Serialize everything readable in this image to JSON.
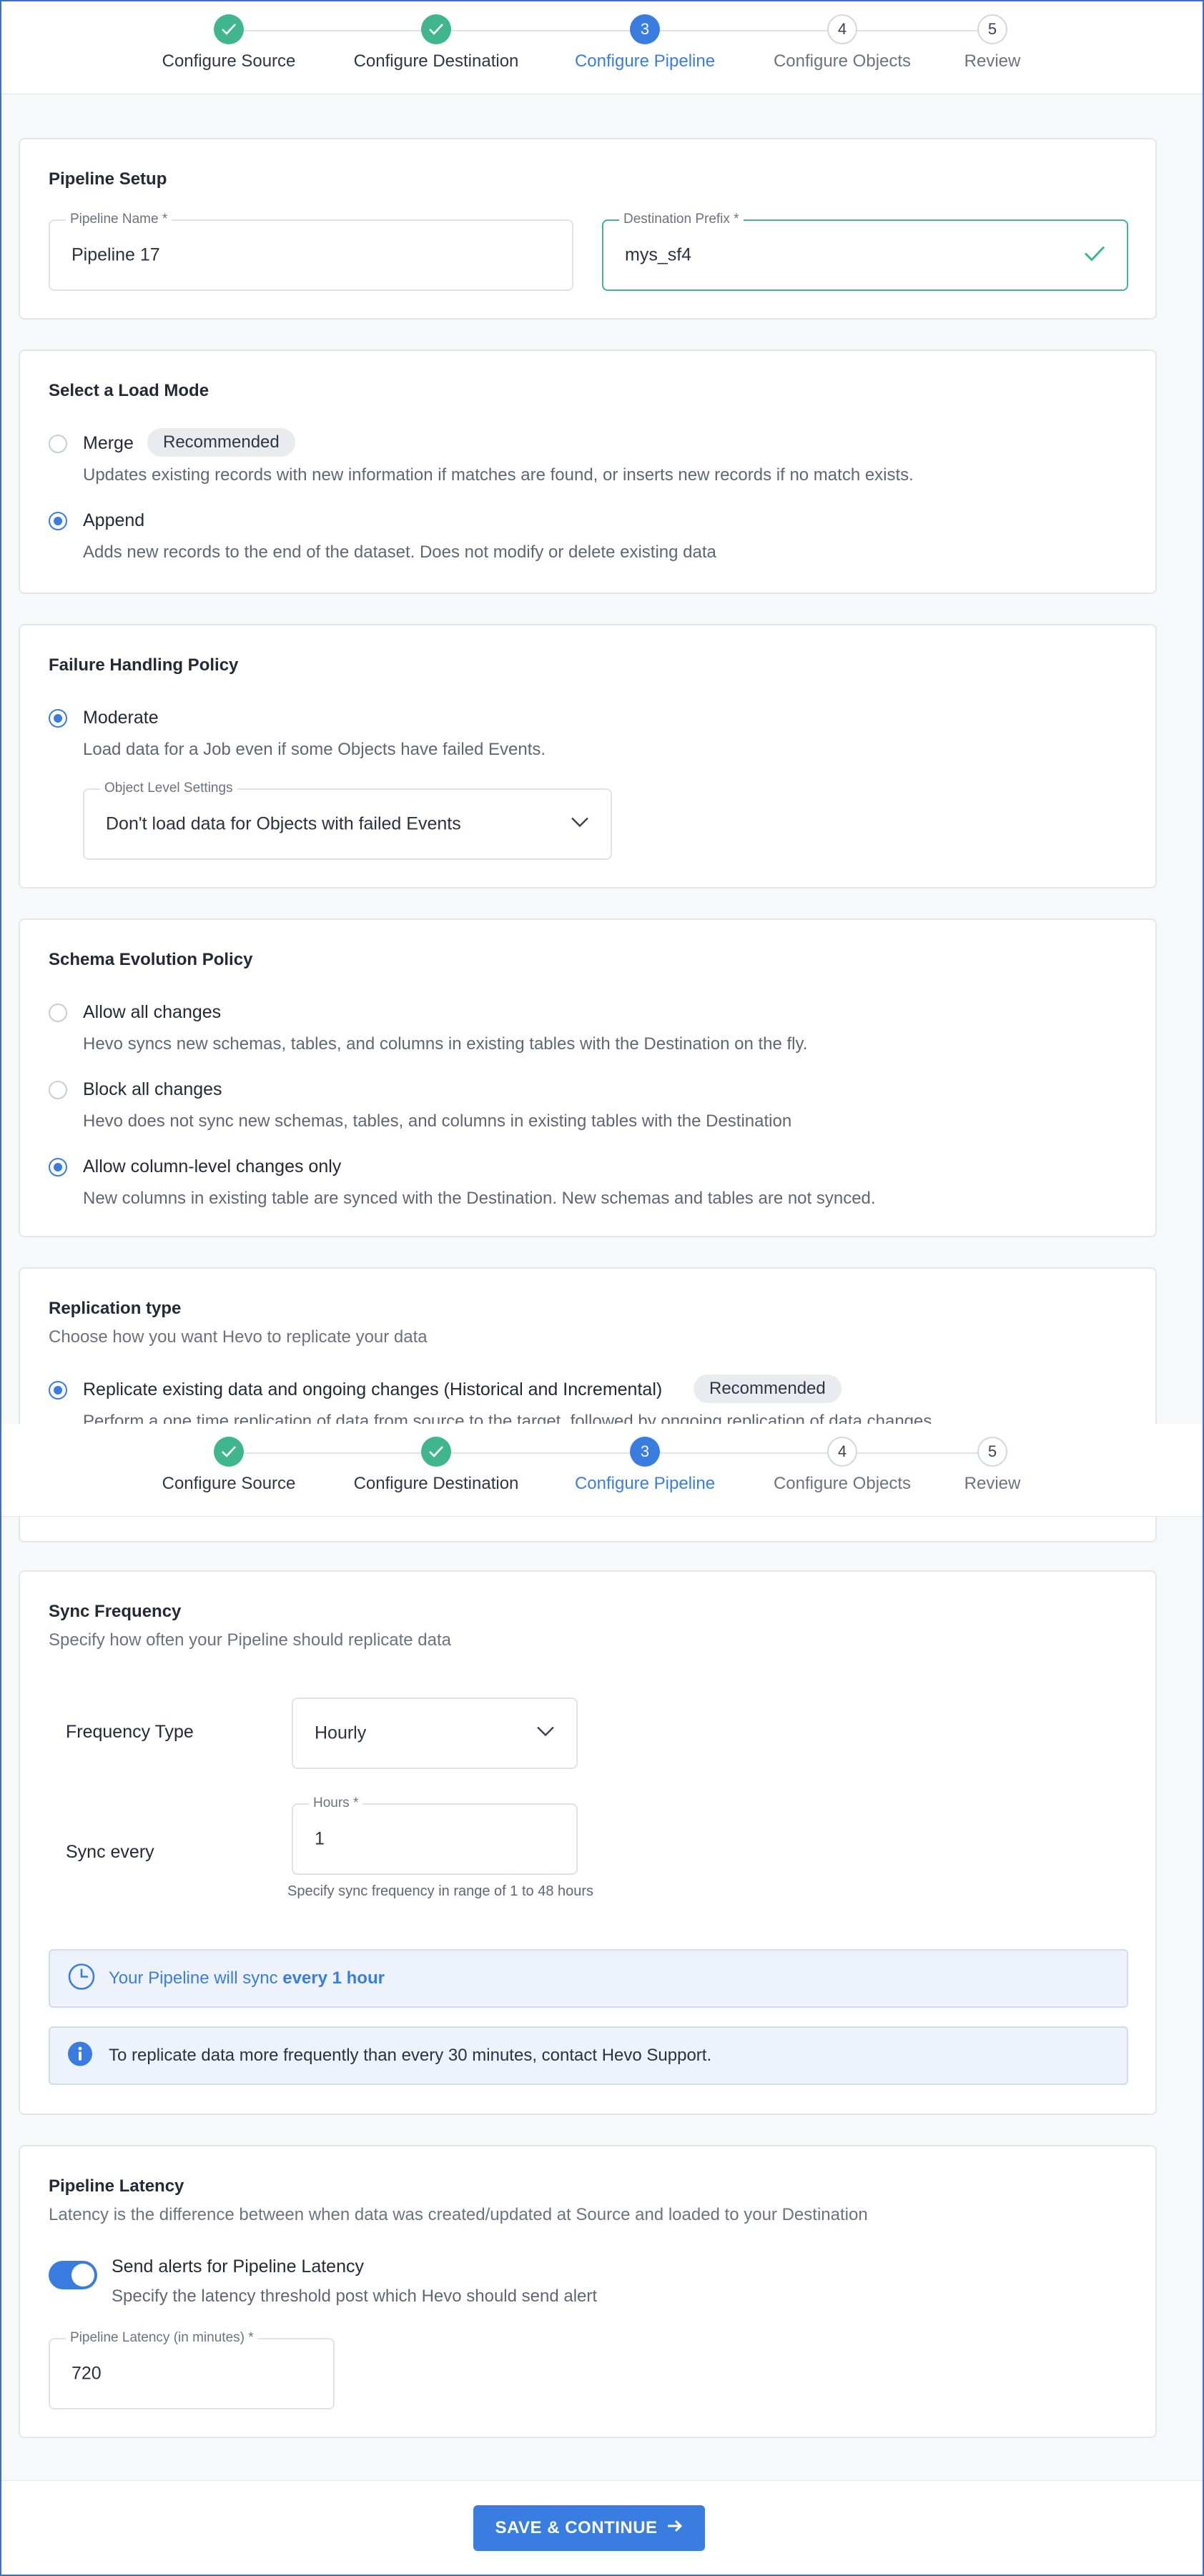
{
  "stepper": {
    "steps": [
      {
        "num": "1",
        "label": "Configure Source",
        "state": "done"
      },
      {
        "num": "2",
        "label": "Configure Destination",
        "state": "done"
      },
      {
        "num": "3",
        "label": "Configure Pipeline",
        "state": "active"
      },
      {
        "num": "4",
        "label": "Configure Objects",
        "state": "todo"
      },
      {
        "num": "5",
        "label": "Review",
        "state": "todo"
      }
    ]
  },
  "pipeline_setup": {
    "title": "Pipeline Setup",
    "name_label": "Pipeline Name *",
    "name_value": "Pipeline 17",
    "prefix_label": "Destination Prefix *",
    "prefix_value": "mys_sf4"
  },
  "load_mode": {
    "title": "Select a Load Mode",
    "options": [
      {
        "label": "Merge",
        "badge": "Recommended",
        "desc": "Updates existing records with new information if matches are found, or inserts new records if no match exists.",
        "selected": false
      },
      {
        "label": "Append",
        "desc": "Adds new records to the end of the dataset. Does not modify or delete existing data",
        "selected": true
      }
    ]
  },
  "failure_policy": {
    "title": "Failure Handling Policy",
    "option_label": "Moderate",
    "option_desc": "Load data for a Job even if some Objects have failed Events.",
    "select_label": "Object Level Settings",
    "select_value": "Don't load data for Objects with failed Events"
  },
  "schema_policy": {
    "title": "Schema Evolution Policy",
    "options": [
      {
        "label": "Allow all changes",
        "desc": "Hevo syncs new schemas, tables, and columns in existing tables with the Destination on the fly.",
        "selected": false
      },
      {
        "label": "Block all changes",
        "desc": "Hevo does not sync new schemas, tables, and columns in existing tables with the Destination",
        "selected": false
      },
      {
        "label": "Allow column-level changes only",
        "desc": "New columns in existing table are synced with the Destination. New schemas and tables are not synced.",
        "selected": true
      }
    ]
  },
  "replication": {
    "title": "Replication type",
    "subtitle": "Choose how you want Hevo to replicate your data",
    "option_label": "Replicate existing data and ongoing changes (Historical and Incremental)",
    "option_badge": "Recommended",
    "option_desc": "Perform a one time replication of data from source to the target, followed by ongoing replication of data changes"
  },
  "sync_frequency": {
    "title": "Sync Frequency",
    "subtitle": "Specify how often your Pipeline should replicate data",
    "type_label": "Frequency Type",
    "type_value": "Hourly",
    "every_label": "Sync every",
    "hours_label": "Hours *",
    "hours_value": "1",
    "hint": "Specify sync frequency in range of 1 to 48 hours",
    "banner_prefix": "Your Pipeline will sync ",
    "banner_bold": "every 1 hour",
    "info": "To replicate data more frequently than every 30 minutes, contact Hevo Support."
  },
  "latency": {
    "title": "Pipeline Latency",
    "subtitle": "Latency is the difference between when data was created/updated at Source and loaded to your Destination",
    "toggle_label": "Send alerts for Pipeline Latency",
    "toggle_desc": "Specify the latency threshold post which Hevo should send alert",
    "toggle_on": true,
    "field_label": "Pipeline Latency (in minutes) *",
    "field_value": "720"
  },
  "footer": {
    "save_label": "SAVE & CONTINUE"
  },
  "colors": {
    "accent": "#3a7de0",
    "success": "#3fb68b"
  }
}
